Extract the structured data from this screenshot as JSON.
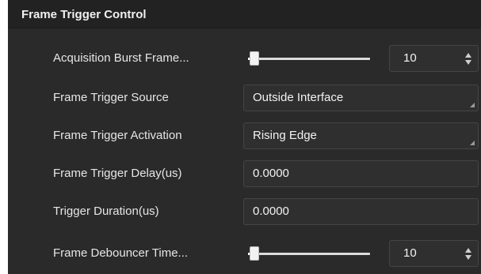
{
  "panel": {
    "title": "Frame Trigger Control"
  },
  "rows": [
    {
      "label": "Acquisition Burst Frame...",
      "type": "slider-spin",
      "value": "10",
      "slider_fraction": 0.0
    },
    {
      "label": "Frame Trigger Source",
      "type": "select",
      "value": "Outside Interface"
    },
    {
      "label": "Frame Trigger Activation",
      "type": "select",
      "value": "Rising Edge"
    },
    {
      "label": "Frame Trigger Delay(us)",
      "type": "text",
      "value": "0.0000"
    },
    {
      "label": "Trigger Duration(us)",
      "type": "text",
      "value": "0.0000"
    },
    {
      "label": "Frame Debouncer Time...",
      "type": "slider-spin",
      "value": "10",
      "slider_fraction": 0.0
    }
  ],
  "icons": {
    "spin_up": "chevron-up-icon",
    "spin_down": "chevron-down-icon",
    "select_arrow": "dropdown-corner-icon"
  },
  "colors": {
    "panel_bg": "#2a2a2a",
    "header_bg": "#222222",
    "field_bg": "#2f2f2f",
    "field_border": "#454545",
    "text": "#e6e6e6"
  }
}
